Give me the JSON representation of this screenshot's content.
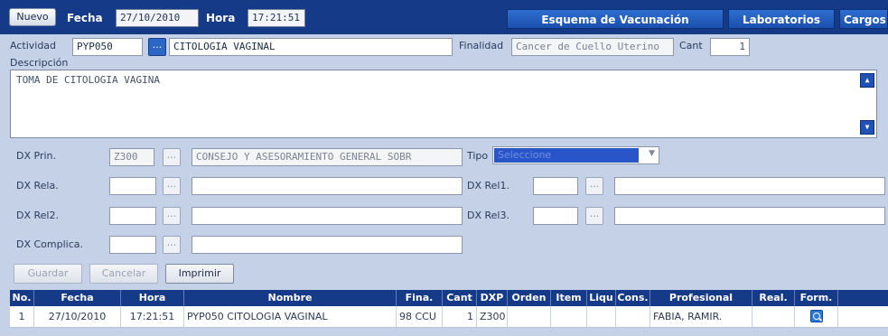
{
  "toolbar": {
    "nuevo_label": "Nuevo",
    "fecha_label": "Fecha",
    "fecha_value": "27/10/2010",
    "hora_label": "Hora",
    "hora_value": "17:21:51",
    "tabs": [
      "Esquema de Vacunación",
      "Laboratorios",
      "Cargos"
    ]
  },
  "actividad": {
    "label": "Actividad",
    "code": "PYP050",
    "lookup_label": "...",
    "name": "CITOLOGIA VAGINAL",
    "finalidad_label": "Finalidad",
    "finalidad_value": "Cancer de Cuello Uterino",
    "cant_label": "Cant",
    "cant_value": "1"
  },
  "descripcion": {
    "label": "Descripción",
    "text": "TOMA DE CITOLOGIA VAGINA"
  },
  "dx": {
    "prin_label": "DX Prin.",
    "prin_code": "Z300",
    "prin_desc": "CONSEJO Y ASESORAMIENTO GENERAL SOBR",
    "tipo_label": "Tipo",
    "tipo_placeholder": "Seleccione",
    "rela_label": "DX Rela.",
    "rel1_label": "DX Rel1.",
    "rel2_label": "DX Rel2.",
    "rel3_label": "DX Rel3.",
    "complica_label": "DX Complica.",
    "lookup_label": "..."
  },
  "actions": {
    "guardar": "Guardar",
    "cancelar": "Cancelar",
    "imprimir": "Imprimir"
  },
  "grid": {
    "headers": [
      "No.",
      "Fecha",
      "Hora",
      "Nombre",
      "Fina.",
      "Cant",
      "DXP",
      "Orden",
      "Item",
      "Liqu",
      "Cons.",
      "Profesional",
      "Real.",
      "Form."
    ],
    "rows": [
      {
        "no": "1",
        "fecha": "27/10/2010",
        "hora": "17:21:51",
        "nombre": "PYP050 CITOLOGIA VAGINAL",
        "fina": "98 CCU",
        "cant": "1",
        "dxp": "Z300",
        "orden": "",
        "item": "",
        "liqu": "",
        "cons": "",
        "profesional": "FABIA, RAMIR.",
        "real": "",
        "form_icon": "search-icon"
      }
    ]
  }
}
